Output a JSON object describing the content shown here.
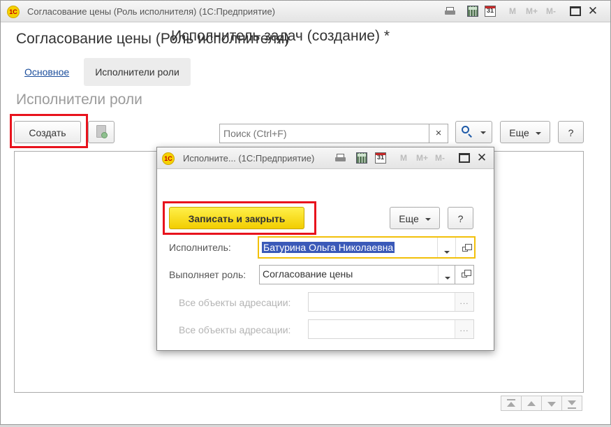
{
  "main_window": {
    "title": "Согласование цены (Роль исполнителя)  (1С:Предприятие)",
    "logo": "1С",
    "memory_buttons": [
      "M",
      "M+",
      "M-"
    ],
    "page_title": "Согласование цены (Роль исполнителя)",
    "tabs": [
      {
        "label": "Основное",
        "active": false
      },
      {
        "label": "Исполнители роли",
        "active": true
      }
    ],
    "section_title": "Исполнители роли",
    "toolbar": {
      "create_label": "Создать",
      "search_placeholder": "Поиск (Ctrl+F)",
      "clear_label": "×",
      "more_label": "Еще",
      "help_label": "?"
    }
  },
  "dialog": {
    "title": "Исполните... (1С:Предприятие)",
    "logo": "1С",
    "memory_buttons": [
      "M",
      "M+",
      "M-"
    ],
    "heading": "Исполнитель задач (создание) *",
    "save_close_label": "Записать и закрыть",
    "more_label": "Еще",
    "help_label": "?",
    "fields": [
      {
        "label": "Исполнитель:",
        "value": "Батурина Ольга Николаевна",
        "enabled": true
      },
      {
        "label": "Выполняет роль:",
        "value": "Согласование цены",
        "enabled": true
      },
      {
        "label": "Все объекты адресации:",
        "value": "",
        "enabled": false
      },
      {
        "label": "Все объекты адресации:",
        "value": "",
        "enabled": false
      }
    ]
  },
  "colors": {
    "highlight_red": "#e8131d",
    "primary_yellow": "#f6d100",
    "link_blue": "#1c4e9c",
    "selection_blue": "#3a59b8"
  },
  "icons": [
    "print-icon",
    "calculator-icon",
    "calendar-icon",
    "maximize-icon",
    "close-icon",
    "copy-icon",
    "search-icon",
    "chevron-down-icon",
    "open-icon",
    "ellipsis-icon",
    "move-first-icon",
    "move-up-icon",
    "move-down-icon",
    "move-last-icon"
  ]
}
